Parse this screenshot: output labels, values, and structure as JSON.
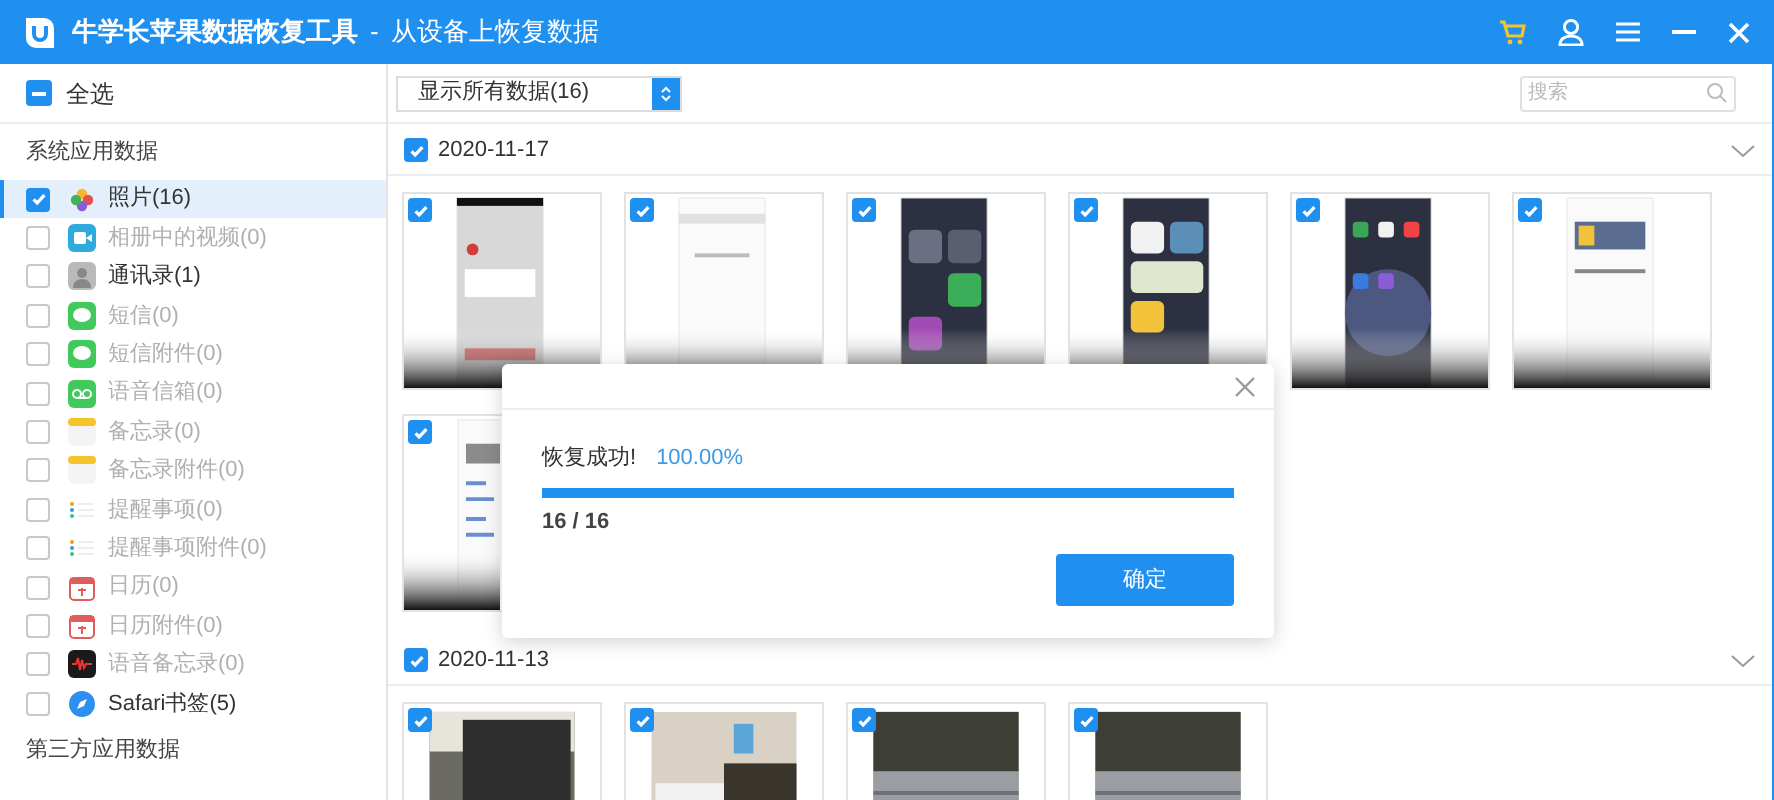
{
  "window": {
    "title": "牛学长苹果数据恢复工具",
    "separator": "-",
    "subtitle": "从设备上恢复数据"
  },
  "sidebar": {
    "select_all": {
      "label": "全选",
      "indeterminate": true
    },
    "sections": [
      {
        "title": "系统应用数据",
        "items": [
          {
            "label": "照片(16)",
            "checked": true,
            "selected": true,
            "disabled": false
          },
          {
            "label": "相册中的视频(0)",
            "checked": false,
            "selected": false,
            "disabled": true
          },
          {
            "label": "通讯录(1)",
            "checked": false,
            "selected": false,
            "disabled": false
          },
          {
            "label": "短信(0)",
            "checked": false,
            "selected": false,
            "disabled": true
          },
          {
            "label": "短信附件(0)",
            "checked": false,
            "selected": false,
            "disabled": true
          },
          {
            "label": "语音信箱(0)",
            "checked": false,
            "selected": false,
            "disabled": true
          },
          {
            "label": "备忘录(0)",
            "checked": false,
            "selected": false,
            "disabled": true
          },
          {
            "label": "备忘录附件(0)",
            "checked": false,
            "selected": false,
            "disabled": true
          },
          {
            "label": "提醒事项(0)",
            "checked": false,
            "selected": false,
            "disabled": true
          },
          {
            "label": "提醒事项附件(0)",
            "checked": false,
            "selected": false,
            "disabled": true
          },
          {
            "label": "日历(0)",
            "checked": false,
            "selected": false,
            "disabled": true
          },
          {
            "label": "日历附件(0)",
            "checked": false,
            "selected": false,
            "disabled": true
          },
          {
            "label": "语音备忘录(0)",
            "checked": false,
            "selected": false,
            "disabled": true
          },
          {
            "label": "Safari书签(5)",
            "checked": false,
            "selected": false,
            "disabled": false
          }
        ]
      },
      {
        "title": "第三方应用数据"
      }
    ]
  },
  "toolbar": {
    "filter": "显示所有数据(16)",
    "search": {
      "placeholder": "搜索"
    }
  },
  "groups": [
    {
      "date": "2020-11-17",
      "checked": true,
      "photos": [
        {
          "checked": true
        },
        {
          "checked": true
        },
        {
          "checked": true
        },
        {
          "checked": true
        },
        {
          "checked": true
        },
        {
          "checked": true
        },
        {
          "checked": true
        }
      ]
    },
    {
      "date": "2020-11-13",
      "checked": true,
      "photos": [
        {
          "checked": true
        },
        {
          "checked": true
        },
        {
          "checked": true
        },
        {
          "checked": true
        }
      ]
    }
  ],
  "dialog": {
    "message": "恢复成功!",
    "percent": "100.00%",
    "level": 1,
    "count": "16 / 16",
    "button": "确定"
  }
}
